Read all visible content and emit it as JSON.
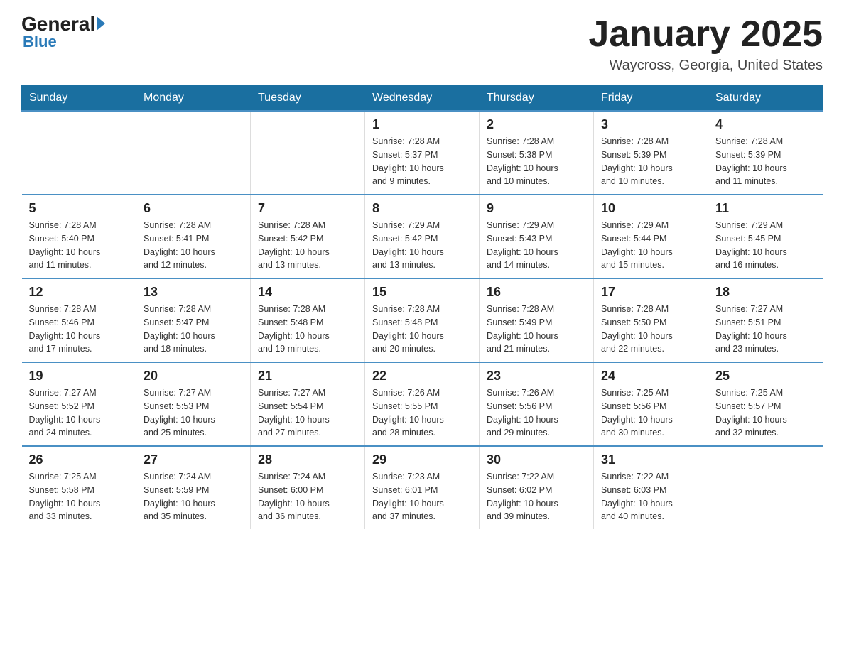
{
  "logo": {
    "text1": "General",
    "text2": "Blue"
  },
  "title": "January 2025",
  "subtitle": "Waycross, Georgia, United States",
  "days_of_week": [
    "Sunday",
    "Monday",
    "Tuesday",
    "Wednesday",
    "Thursday",
    "Friday",
    "Saturday"
  ],
  "weeks": [
    [
      {
        "day": "",
        "info": ""
      },
      {
        "day": "",
        "info": ""
      },
      {
        "day": "",
        "info": ""
      },
      {
        "day": "1",
        "info": "Sunrise: 7:28 AM\nSunset: 5:37 PM\nDaylight: 10 hours\nand 9 minutes."
      },
      {
        "day": "2",
        "info": "Sunrise: 7:28 AM\nSunset: 5:38 PM\nDaylight: 10 hours\nand 10 minutes."
      },
      {
        "day": "3",
        "info": "Sunrise: 7:28 AM\nSunset: 5:39 PM\nDaylight: 10 hours\nand 10 minutes."
      },
      {
        "day": "4",
        "info": "Sunrise: 7:28 AM\nSunset: 5:39 PM\nDaylight: 10 hours\nand 11 minutes."
      }
    ],
    [
      {
        "day": "5",
        "info": "Sunrise: 7:28 AM\nSunset: 5:40 PM\nDaylight: 10 hours\nand 11 minutes."
      },
      {
        "day": "6",
        "info": "Sunrise: 7:28 AM\nSunset: 5:41 PM\nDaylight: 10 hours\nand 12 minutes."
      },
      {
        "day": "7",
        "info": "Sunrise: 7:28 AM\nSunset: 5:42 PM\nDaylight: 10 hours\nand 13 minutes."
      },
      {
        "day": "8",
        "info": "Sunrise: 7:29 AM\nSunset: 5:42 PM\nDaylight: 10 hours\nand 13 minutes."
      },
      {
        "day": "9",
        "info": "Sunrise: 7:29 AM\nSunset: 5:43 PM\nDaylight: 10 hours\nand 14 minutes."
      },
      {
        "day": "10",
        "info": "Sunrise: 7:29 AM\nSunset: 5:44 PM\nDaylight: 10 hours\nand 15 minutes."
      },
      {
        "day": "11",
        "info": "Sunrise: 7:29 AM\nSunset: 5:45 PM\nDaylight: 10 hours\nand 16 minutes."
      }
    ],
    [
      {
        "day": "12",
        "info": "Sunrise: 7:28 AM\nSunset: 5:46 PM\nDaylight: 10 hours\nand 17 minutes."
      },
      {
        "day": "13",
        "info": "Sunrise: 7:28 AM\nSunset: 5:47 PM\nDaylight: 10 hours\nand 18 minutes."
      },
      {
        "day": "14",
        "info": "Sunrise: 7:28 AM\nSunset: 5:48 PM\nDaylight: 10 hours\nand 19 minutes."
      },
      {
        "day": "15",
        "info": "Sunrise: 7:28 AM\nSunset: 5:48 PM\nDaylight: 10 hours\nand 20 minutes."
      },
      {
        "day": "16",
        "info": "Sunrise: 7:28 AM\nSunset: 5:49 PM\nDaylight: 10 hours\nand 21 minutes."
      },
      {
        "day": "17",
        "info": "Sunrise: 7:28 AM\nSunset: 5:50 PM\nDaylight: 10 hours\nand 22 minutes."
      },
      {
        "day": "18",
        "info": "Sunrise: 7:27 AM\nSunset: 5:51 PM\nDaylight: 10 hours\nand 23 minutes."
      }
    ],
    [
      {
        "day": "19",
        "info": "Sunrise: 7:27 AM\nSunset: 5:52 PM\nDaylight: 10 hours\nand 24 minutes."
      },
      {
        "day": "20",
        "info": "Sunrise: 7:27 AM\nSunset: 5:53 PM\nDaylight: 10 hours\nand 25 minutes."
      },
      {
        "day": "21",
        "info": "Sunrise: 7:27 AM\nSunset: 5:54 PM\nDaylight: 10 hours\nand 27 minutes."
      },
      {
        "day": "22",
        "info": "Sunrise: 7:26 AM\nSunset: 5:55 PM\nDaylight: 10 hours\nand 28 minutes."
      },
      {
        "day": "23",
        "info": "Sunrise: 7:26 AM\nSunset: 5:56 PM\nDaylight: 10 hours\nand 29 minutes."
      },
      {
        "day": "24",
        "info": "Sunrise: 7:25 AM\nSunset: 5:56 PM\nDaylight: 10 hours\nand 30 minutes."
      },
      {
        "day": "25",
        "info": "Sunrise: 7:25 AM\nSunset: 5:57 PM\nDaylight: 10 hours\nand 32 minutes."
      }
    ],
    [
      {
        "day": "26",
        "info": "Sunrise: 7:25 AM\nSunset: 5:58 PM\nDaylight: 10 hours\nand 33 minutes."
      },
      {
        "day": "27",
        "info": "Sunrise: 7:24 AM\nSunset: 5:59 PM\nDaylight: 10 hours\nand 35 minutes."
      },
      {
        "day": "28",
        "info": "Sunrise: 7:24 AM\nSunset: 6:00 PM\nDaylight: 10 hours\nand 36 minutes."
      },
      {
        "day": "29",
        "info": "Sunrise: 7:23 AM\nSunset: 6:01 PM\nDaylight: 10 hours\nand 37 minutes."
      },
      {
        "day": "30",
        "info": "Sunrise: 7:22 AM\nSunset: 6:02 PM\nDaylight: 10 hours\nand 39 minutes."
      },
      {
        "day": "31",
        "info": "Sunrise: 7:22 AM\nSunset: 6:03 PM\nDaylight: 10 hours\nand 40 minutes."
      },
      {
        "day": "",
        "info": ""
      }
    ]
  ]
}
